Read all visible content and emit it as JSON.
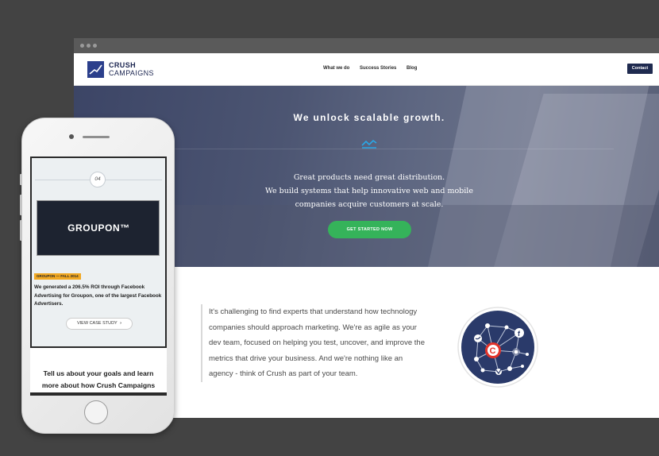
{
  "desktop": {
    "logo": {
      "line1": "CRUSH",
      "line2": "CAMPAIGNS"
    },
    "nav": {
      "items": [
        "What we do",
        "Success Stories",
        "Blog"
      ],
      "contact_label": "Contact"
    },
    "hero": {
      "title": "We unlock scalable growth.",
      "subtitle_lines": [
        "Great products need great distribution.",
        "We build systems that help innovative web and mobile",
        "companies acquire customers at scale."
      ],
      "cta_label": "GET STARTED NOW"
    },
    "quote_lines": [
      "It's challenging to find experts that understand how technology",
      "companies should approach marketing. We're as agile as your",
      "dev team, focused on helping you test, uncover, and improve the",
      "metrics that drive your business. And we're nothing like an",
      "agency - think of Crush as part of your team."
    ],
    "network_center": "C",
    "network_icons": [
      "twitter-icon",
      "facebook-icon",
      "instagram-icon",
      "vine-icon"
    ]
  },
  "phone": {
    "case_number": "04",
    "brand": "GROUPON™",
    "tag": "GROUPON — FALL 2014",
    "description": "We generated a 206.5% ROI through Facebook Advertising for Groupon, one of the largest Facebook Advertisers.",
    "button_label": "VIEW CASE STUDY",
    "button_chevron": "›",
    "cta_line1": "Tell us about your goals and learn",
    "cta_line2": "more about how Crush Campaigns"
  },
  "colors": {
    "accent_green": "#35b35a",
    "navy": "#1f2a4f",
    "tag_orange": "#f1a823",
    "network_red": "#e2332a"
  }
}
